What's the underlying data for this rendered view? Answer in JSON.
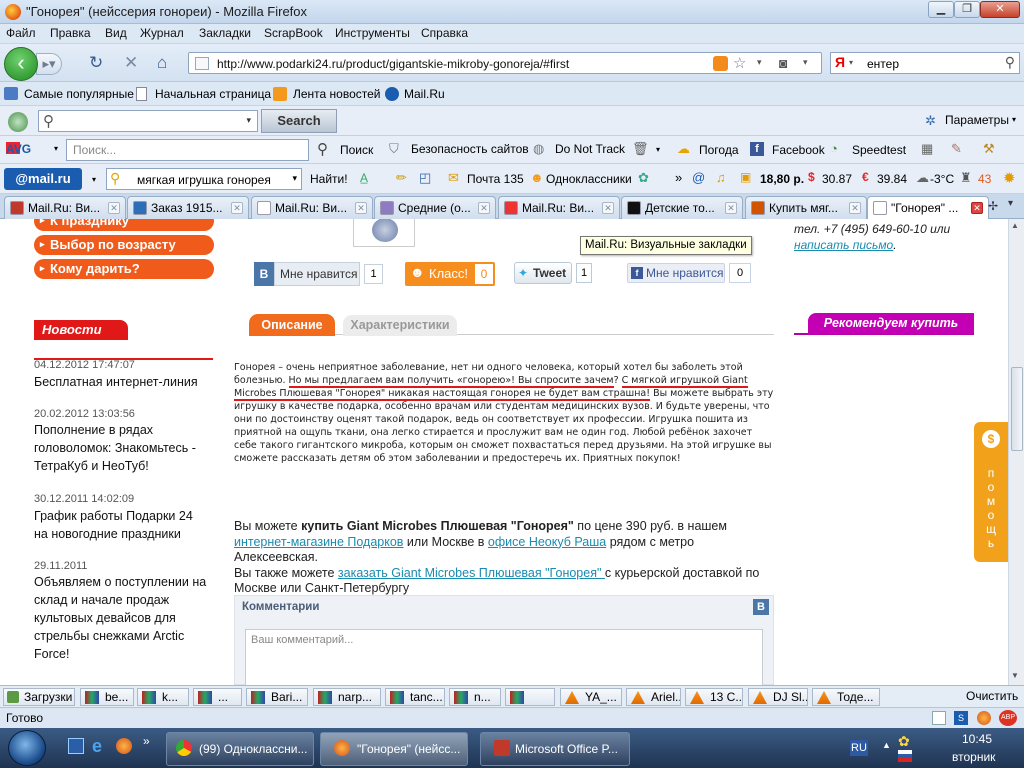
{
  "window": {
    "title": "\"Гонорея\" (нейссерия гонореи) - Mozilla Firefox"
  },
  "menu": [
    "Файл",
    "Правка",
    "Вид",
    "Журнал",
    "Закладки",
    "ScrapBook",
    "Инструменты",
    "Справка"
  ],
  "nav": {
    "url": "http://www.podarki24.ru/product/gigantskie-mikroby-gonoreja/#first",
    "search_value": "ентер",
    "search_engine": "Я"
  },
  "bookmarks": [
    "Самые популярные",
    "Начальная страница",
    "Лента новостей",
    "Mail.Ru"
  ],
  "toolbar1": {
    "search_button": "Search",
    "params": "Параметры"
  },
  "toolbar2": {
    "brand": "AVG",
    "placeholder": "Поиск...",
    "search": "Поиск",
    "security": "Безопасность сайтов",
    "dnt": "Do Not Track",
    "weather": "Погода",
    "facebook": "Facebook",
    "speedtest": "Speedtest"
  },
  "toolbar3": {
    "brand": "@mail.ru",
    "query": "мягкая игрушка гонорея",
    "find": "Найти!",
    "mail": "Почта 135",
    "ok": "Одноклассники",
    "money": "18,80 р.",
    "usd": "30.87",
    "eur": "39.84",
    "temp": "-3°C",
    "count": "43"
  },
  "tabs": [
    {
      "label": "Mail.Ru: Ви...",
      "color": "#c0392b"
    },
    {
      "label": "Заказ 1915...",
      "color": "#2a6fb8"
    },
    {
      "label": "Mail.Ru: Ви...",
      "color": "#fff"
    },
    {
      "label": "Средние (о...",
      "color": "#8e7cc3"
    },
    {
      "label": "Mail.Ru: Ви...",
      "color": "#e33"
    },
    {
      "label": "Детские то...",
      "color": "#111"
    },
    {
      "label": "Купить мяг...",
      "color": "#d35400"
    },
    {
      "label": "\"Гонорея\" ...",
      "color": "#fff"
    }
  ],
  "sidebar": {
    "menu": [
      "К празднику",
      "Выбор по возрасту",
      "Кому дарить?"
    ],
    "news_title": "Новости",
    "news": [
      {
        "date": "04.12.2012 17:47:07",
        "text": "Бесплатная интернет-линия"
      },
      {
        "date": "20.02.2012 13:03:56",
        "text": "Пополнение в рядах головоломок: Знакомьтесь - ТетраКуб и НеоТуб!"
      },
      {
        "date": "30.12.2011 14:02:09",
        "text": "График работы Подарки 24 на новогодние праздники"
      },
      {
        "date": "29.11.2011",
        "text": "Объявляем о поступлении на склад и начале продаж культовых девайсов для стрельбы снежками Arctic Force!"
      }
    ]
  },
  "social": {
    "vk_like": "Мне нравится",
    "vk_count": "1",
    "ok_label": "Класс!",
    "ok_count": "0",
    "tweet": "Tweet",
    "tweet_count": "1",
    "fb_like": "Мне нравится",
    "fb_count": "0"
  },
  "tooltip": "Mail.Ru: Визуальные закладки",
  "product_tabs": [
    "Описание",
    "Характеристики"
  ],
  "description": {
    "p1": "Гонорея – очень неприятное заболевание, нет ни одного человека, который хотел бы заболеть этой болезнью. ",
    "p2": "Но мы предлагаем вам получить «гонорею»! Вы спросите зачем",
    "p3": "? ",
    "p4": "С мягкой игрушкой Giant Microbes Плюшевая \"Гонорея\" никакая настоящая гонорея не будет вам страшна!",
    "p5": " Вы можете выбрать эту игрушку в качестве подарка, особенно врачам или студентам медицинских вузов. И будьте уверены, что они по достоинству оценят такой подарок, ведь он соответствует их профессии. Игрушка пошита из приятной на ощупь ткани, она легко стирается и прослужит вам не один год. Любой ребёнок захочет себе такого гигантского микроба, которым он сможет похвастаться перед друзьями. На этой игрушке вы сможете рассказать детям об этом заболевании и предостеречь их. Приятных покупок!"
  },
  "buy": {
    "t1": "Вы можете ",
    "b1": "купить Giant Microbes Плюшевая \"Гонорея\"",
    "t2": " по цене 390 руб. в нашем ",
    "l1": "интернет-магазине Подарков",
    "t3": " или Москве в ",
    "l2": "офисе Неокуб Раша",
    "t4": " рядом с метро Алексеевская.",
    "t5": "Вы также можете ",
    "l3": "заказать Giant Microbes Плюшевая \"Гонорея\" ",
    "t6": " с курьерской доставкой по Москве или Санкт-Петербургу"
  },
  "comments": {
    "title": "Комментарии",
    "placeholder": "Ваш комментарий..."
  },
  "right": {
    "phone": "тел. +7 (495) 649-60-10 или",
    "write": "написать письмо",
    "recommend": "Рекомендуем купить",
    "help": "помощь"
  },
  "downloads": {
    "label": "Загрузки",
    "items": [
      "be...",
      "k...",
      "...",
      "Bari...",
      "narp...",
      "tanc...",
      "n...",
      "",
      "YA_...",
      "Ariel...",
      "13 С...",
      "DJ Sl...",
      "Тоде..."
    ],
    "clear": "Очистить"
  },
  "status": {
    "text": "Готово"
  },
  "taskbar": {
    "items": [
      "(99) Одноклассни...",
      "\"Гонорея\" (нейсс...",
      "Microsoft Office P..."
    ],
    "lang": "RU",
    "time": "10:45",
    "day": "вторник"
  }
}
